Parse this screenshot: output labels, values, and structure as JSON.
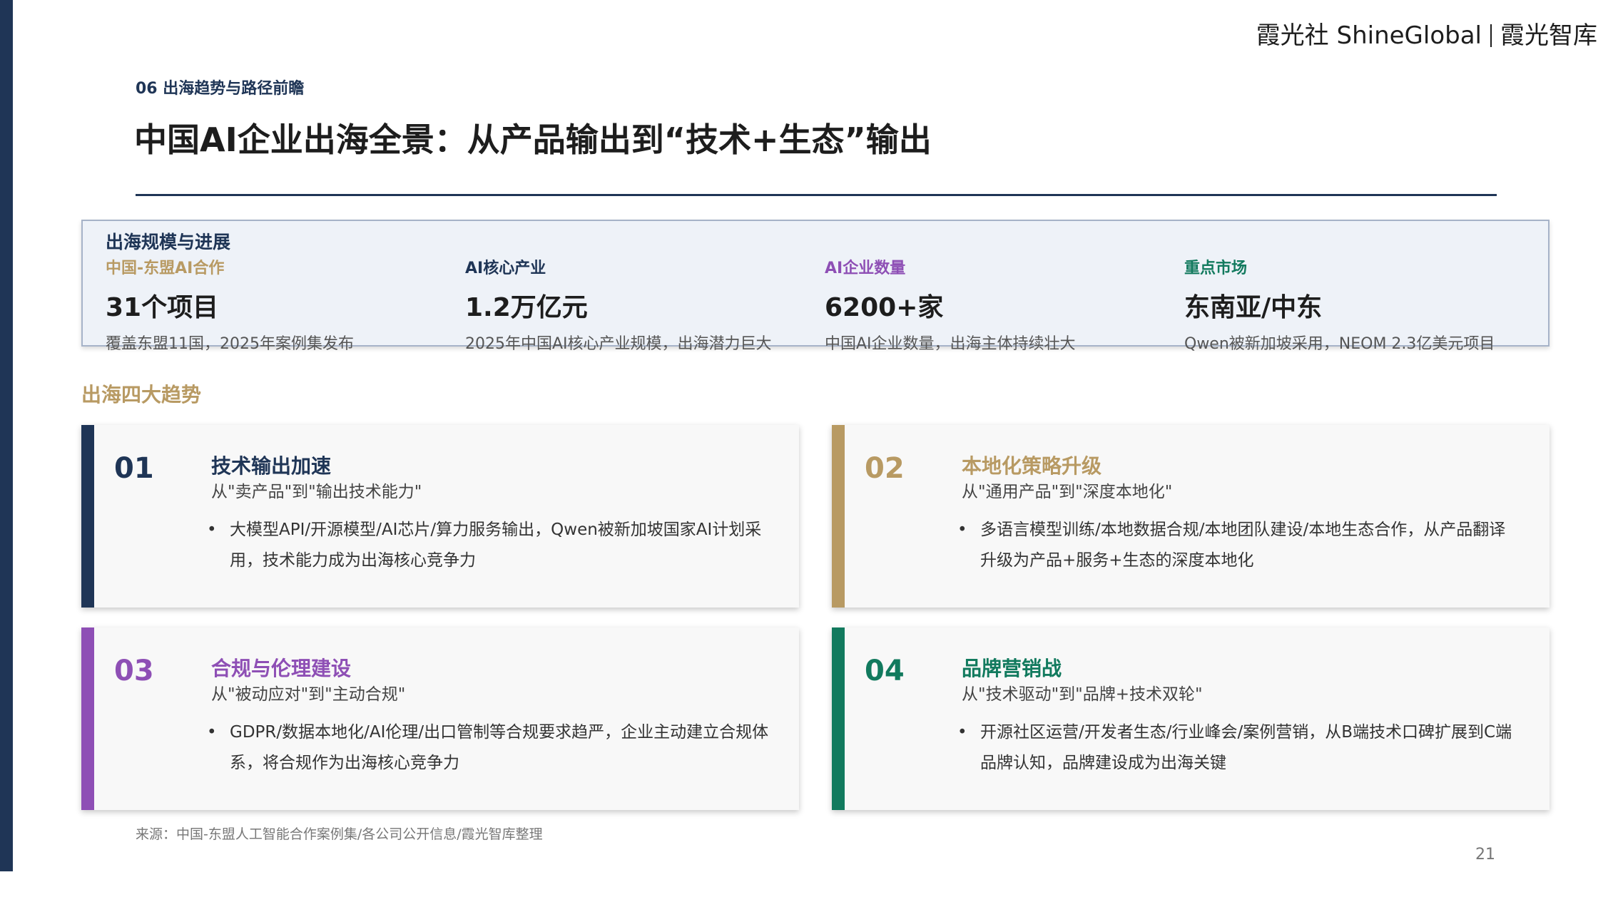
{
  "brand": {
    "left": "霞光社 ShineGlobal",
    "right": "霞光智库"
  },
  "section_tag": "06 出海趋势与路径前瞻",
  "title": "中国AI企业出海全景：从产品输出到“技术+生态”输出",
  "stats": {
    "heading": "出海规模与进展",
    "items": [
      {
        "label": "中国-东盟AI合作",
        "value": "31个项目",
        "desc": "覆盖东盟11国，2025年案例集发布",
        "color": "#b89a63"
      },
      {
        "label": "AI核心产业",
        "value": "1.2万亿元",
        "desc": "2025年中国AI核心产业规模，出海潜力巨大",
        "color": "#1f3556"
      },
      {
        "label": "AI企业数量",
        "value": "6200+家",
        "desc": "中国AI企业数量，出海主体持续壮大",
        "color": "#8e4fb5"
      },
      {
        "label": "重点市场",
        "value": "东南亚/中东",
        "desc": "Qwen被新加坡采用，NEOM 2.3亿美元项目",
        "color": "#127a5e"
      }
    ]
  },
  "trends_title": "出海四大趋势",
  "cards": [
    {
      "num": "01",
      "title": "技术输出加速",
      "sub": "从\"卖产品\"到\"输出技术能力\"",
      "bullet": "大模型API/开源模型/AI芯片/算力服务输出，Qwen被新加坡国家AI计划采用，技术能力成为出海核心竞争力",
      "color": "#1f3556"
    },
    {
      "num": "02",
      "title": "本地化策略升级",
      "sub": "从\"通用产品\"到\"深度本地化\"",
      "bullet": "多语言模型训练/本地数据合规/本地团队建设/本地生态合作，从产品翻译升级为产品+服务+生态的深度本地化",
      "color": "#b89a63"
    },
    {
      "num": "03",
      "title": "合规与伦理建设",
      "sub": "从\"被动应对\"到\"主动合规\"",
      "bullet": "GDPR/数据本地化/AI伦理/出口管制等合规要求趋严，企业主动建立合规体系，将合规作为出海核心竞争力",
      "color": "#8e4fb5"
    },
    {
      "num": "04",
      "title": "品牌营销战",
      "sub": "从\"技术驱动\"到\"品牌+技术双轮\"",
      "bullet": "开源社区运营/开发者生态/行业峰会/案例营销，从B端技术口碑扩展到C端品牌认知，品牌建设成为出海关键",
      "color": "#127a5e"
    }
  ],
  "source": "来源：中国-东盟人工智能合作案例集/各公司公开信息/霞光智库整理",
  "page_number": "21"
}
